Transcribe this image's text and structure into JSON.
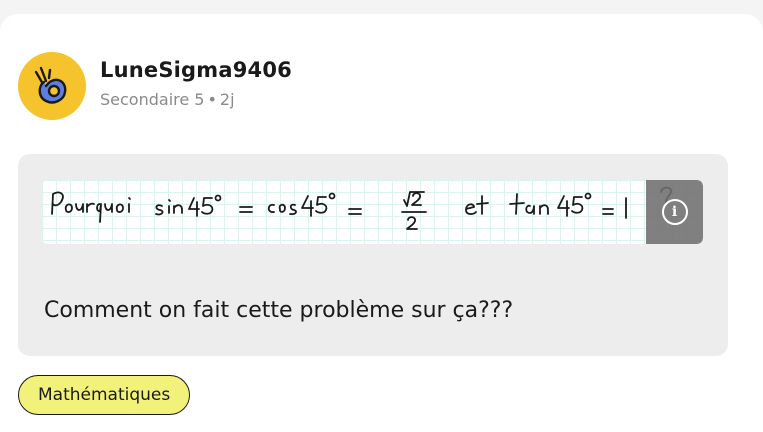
{
  "post": {
    "author": "LuneSigma9406",
    "grade": "Secondaire 5",
    "separator": "•",
    "age": "2j",
    "image": {
      "handwritten_text": "Pourquoi sin 45° = cos 45° = √2/2 et tan 45° = 1 ?",
      "info_icon": "info-icon"
    },
    "body_text": "Comment on fait cette problème sur ça???",
    "tag": "Mathématiques"
  },
  "colors": {
    "avatar_bg": "#f5c32c",
    "avatar_hand": "#5d7fe0",
    "tag_bg": "#f2f27a",
    "post_bg": "#ededed",
    "grid_line": "#dcf3ee"
  }
}
